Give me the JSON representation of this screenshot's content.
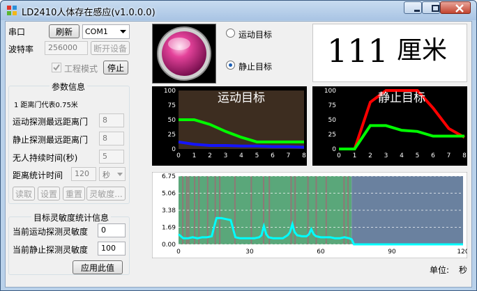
{
  "window": {
    "title": "LD2410人体存在感应(v1.0.0.0)"
  },
  "serial": {
    "port_label": "串口",
    "refresh_label": "刷新",
    "port_value": "COM1",
    "baud_label": "波特率",
    "baud_value": "256000",
    "disconnect_label": "断开设备",
    "engineering_mode_label": "工程模式",
    "stop_label": "停止"
  },
  "params": {
    "title": "参数信息",
    "gate_note": "1 距离门代表0.75米",
    "move_min_label": "运动探测最远距离门",
    "move_min_value": "8",
    "static_min_label": "静止探测最远距离门",
    "static_min_value": "8",
    "nobody_label": "无人持续时间(秒)",
    "nobody_value": "5",
    "stat_time_label": "距离统计时间",
    "stat_time_value": "120",
    "stat_unit": "秒",
    "read_label": "读取",
    "set_label": "设置",
    "reset_label": "重置",
    "sensitivity_label": "灵敏度..."
  },
  "sensitivity": {
    "title": "目标灵敏度统计信息",
    "move_label": "当前运动探测灵敏度",
    "move_value": "0",
    "static_label": "当前静止探测灵敏度",
    "static_value": "100",
    "apply_label": "应用此值"
  },
  "status": {
    "moving_label": "运动目标",
    "static_label": "静止目标",
    "selected": "static",
    "distance_value": "111",
    "distance_unit": "厘米",
    "indicator_color": "#e4429a"
  },
  "unit_label": "单位:",
  "unit_value": "秒",
  "chart_data": [
    {
      "type": "line",
      "title": "运动目标",
      "x": [
        0,
        1,
        2,
        3,
        4,
        5,
        6,
        7,
        8
      ],
      "ylim": [
        0,
        100
      ],
      "yticks": [
        "100",
        "75",
        "50",
        "25",
        "0"
      ],
      "xticks": [
        "0",
        "1",
        "2",
        "3",
        "4",
        "5",
        "6",
        "7",
        "8"
      ],
      "series": [
        {
          "color": "#00ff00",
          "values": [
            50,
            50,
            42,
            30,
            20,
            12,
            12,
            12,
            12
          ]
        },
        {
          "color": "#1414ff",
          "values": [
            12,
            8,
            6,
            6,
            5,
            5,
            4,
            4,
            3
          ]
        }
      ],
      "background": "#3d2d20"
    },
    {
      "type": "line",
      "title": "静止目标",
      "x": [
        0,
        1,
        2,
        3,
        4,
        5,
        6,
        7,
        8
      ],
      "ylim": [
        0,
        100
      ],
      "yticks": [
        "100",
        "75",
        "50",
        "25",
        "0"
      ],
      "xticks": [
        "0",
        "1",
        "2",
        "3",
        "4",
        "5",
        "6",
        "7",
        "8"
      ],
      "series": [
        {
          "color": "#ff0000",
          "values": [
            0,
            0,
            80,
            100,
            100,
            100,
            70,
            35,
            20
          ]
        },
        {
          "color": "#00ff00",
          "values": [
            0,
            0,
            40,
            40,
            32,
            30,
            22,
            22,
            22
          ]
        }
      ],
      "background": "#000000"
    },
    {
      "type": "line",
      "xlim": [
        0,
        120
      ],
      "ylim": [
        0,
        6.75
      ],
      "yticks": [
        "6.75",
        "5.06",
        "3.38",
        "1.69",
        "0.00"
      ],
      "xticks": [
        "0",
        "30",
        "60",
        "90",
        "120"
      ],
      "regions": [
        {
          "from": 0,
          "to": 73,
          "color": "#5aa77a"
        },
        {
          "from": 73,
          "to": 120,
          "color": "#6a819f"
        }
      ],
      "series": [
        {
          "color": "#00ffff",
          "x": [
            0,
            2,
            4,
            6,
            8,
            10,
            12,
            14,
            16,
            17,
            18,
            20,
            22,
            24,
            26,
            28,
            30,
            32,
            34,
            35,
            36,
            37,
            38,
            40,
            42,
            44,
            46,
            47,
            48,
            49,
            50,
            52,
            54,
            55,
            56,
            57,
            58,
            60,
            62,
            64,
            66,
            68,
            70,
            72,
            73,
            74,
            80,
            90,
            100,
            110,
            120
          ],
          "values": [
            1.0,
            0.6,
            0.6,
            0.7,
            0.6,
            0.7,
            0.7,
            0.8,
            2.6,
            2.6,
            2.6,
            2.5,
            2.4,
            0.7,
            0.6,
            0.6,
            0.6,
            0.6,
            0.7,
            0.9,
            1.8,
            1.0,
            0.7,
            0.6,
            0.6,
            0.6,
            0.9,
            1.2,
            2.0,
            1.2,
            0.9,
            0.8,
            0.8,
            1.0,
            1.5,
            1.0,
            0.8,
            0.7,
            0.7,
            0.7,
            0.6,
            0.6,
            0.7,
            0.6,
            0.5,
            0.0,
            0.0,
            0.0,
            0.0,
            0.0,
            0.0
          ]
        }
      ],
      "background": "#ffffff"
    }
  ]
}
